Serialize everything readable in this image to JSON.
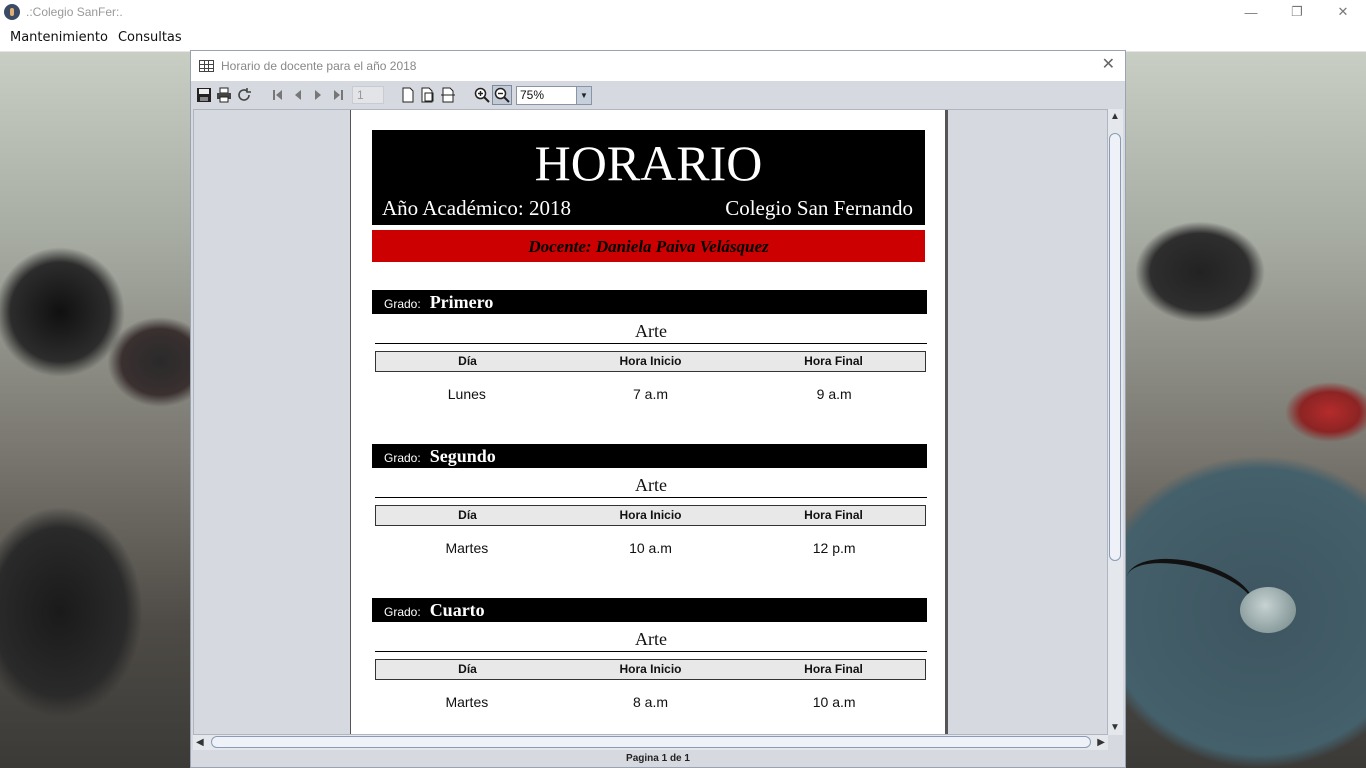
{
  "window": {
    "title": ".:Colegio SanFer:.",
    "controls": {
      "minimize": "—",
      "maximize": "❐",
      "close": "✕"
    }
  },
  "menu": {
    "items": [
      "Mantenimiento",
      "Consultas"
    ]
  },
  "inner_frame": {
    "title": "Horario de docente para el año 2018",
    "close": "✕"
  },
  "toolbar": {
    "page_number": "1",
    "zoom": "75%",
    "icons": [
      "save-icon",
      "print-icon",
      "reload-icon",
      "first-page-icon",
      "previous-page-icon",
      "next-page-icon",
      "last-page-icon",
      "actual-size-icon",
      "fit-page-icon",
      "fit-width-icon",
      "zoom-in-icon",
      "zoom-out-icon"
    ]
  },
  "report": {
    "title": "HORARIO",
    "year_label": "Año Académico: 2018",
    "school": "Colegio San Fernando",
    "docente": "Docente: Daniela Paiva Velásquez",
    "grado_label": "Grado:",
    "columns": [
      "Día",
      "Hora Inicio",
      "Hora Final"
    ],
    "sections": [
      {
        "grado": "Primero",
        "course": "Arte",
        "row": [
          "Lunes",
          "7 a.m",
          "9 a.m"
        ]
      },
      {
        "grado": "Segundo",
        "course": "Arte",
        "row": [
          "Martes",
          "10 a.m",
          "12 p.m"
        ]
      },
      {
        "grado": "Cuarto",
        "course": "Arte",
        "row": [
          "Martes",
          "8 a.m",
          "10 a.m"
        ]
      }
    ]
  },
  "status": "Pagina 1 de 1",
  "colors": {
    "header_bg": "#000000",
    "docente_bg": "#cc0000",
    "frame_bg": "#d6d9df"
  }
}
